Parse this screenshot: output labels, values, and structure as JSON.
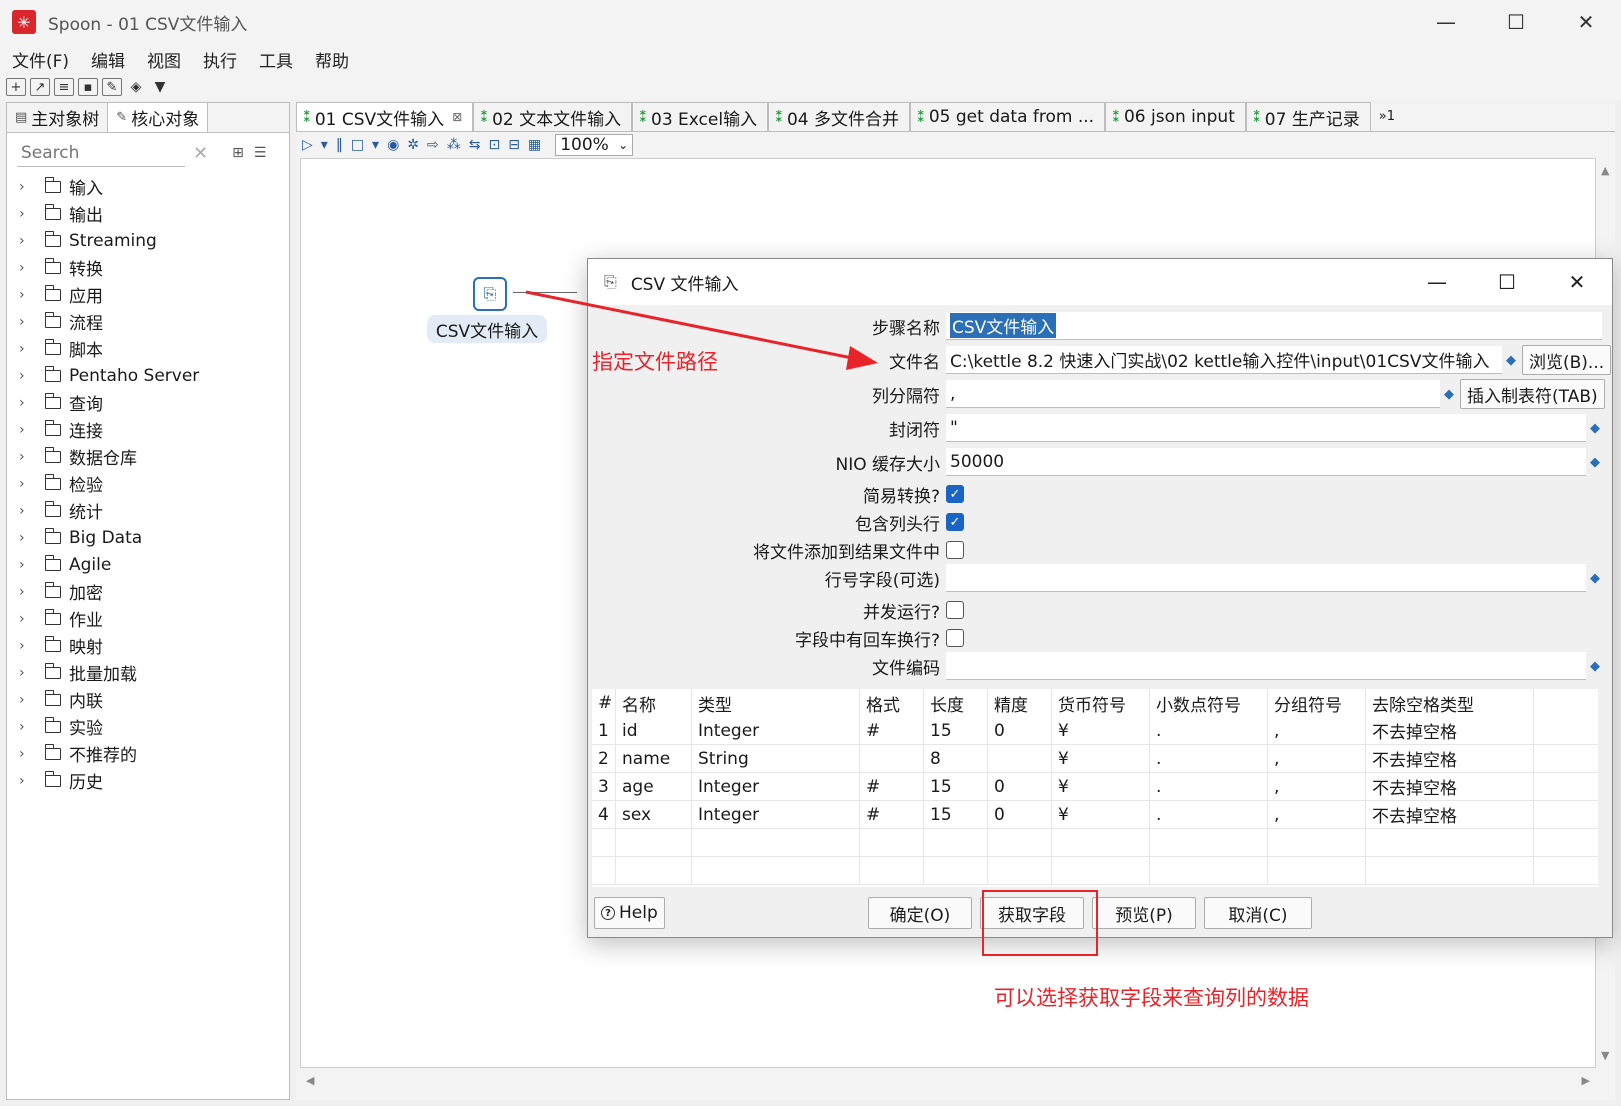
{
  "window": {
    "title": "Spoon - 01 CSV文件输入",
    "logo_icon": "spoon-logo-icon",
    "minimize": "—",
    "maximize": "☐",
    "close": "✕"
  },
  "menu": [
    "文件(F)",
    "编辑",
    "视图",
    "执行",
    "工具",
    "帮助"
  ],
  "left_panel": {
    "tabs": [
      "主对象树",
      "核心对象"
    ],
    "search_placeholder": "Search",
    "tree": [
      "输入",
      "输出",
      "Streaming",
      "转换",
      "应用",
      "流程",
      "脚本",
      "Pentaho Server",
      "查询",
      "连接",
      "数据仓库",
      "检验",
      "统计",
      "Big Data",
      "Agile",
      "加密",
      "作业",
      "映射",
      "批量加载",
      "内联",
      "实验",
      "不推荐的",
      "历史"
    ]
  },
  "editor": {
    "tabs": [
      "01 CSV文件输入",
      "02 文本文件输入",
      "03 Excel输入",
      "04 多文件合并",
      "05 get data from ...",
      "06 json input",
      "07 生产记录"
    ],
    "tab_more": "»1",
    "zoom": "100%",
    "step_label": "CSV文件输入"
  },
  "dialog": {
    "title": "CSV 文件输入",
    "fields": {
      "step_name_label": "步骤名称",
      "step_name_value": "CSV文件输入",
      "filename_label": "文件名",
      "filename_value": "C:\\kettle 8.2 快速入门实战\\02 kettle输入控件\\input\\01CSV文件输入",
      "browse_button": "浏览(B)...",
      "delimiter_label": "列分隔符",
      "delimiter_value": ",",
      "insert_tab_button": "插入制表符(TAB)",
      "enclosure_label": "封闭符",
      "enclosure_value": "\"",
      "nio_label": "NIO 缓存大小",
      "nio_value": "50000",
      "lazy_label": "简易转换?",
      "lazy_checked": true,
      "header_label": "包含列头行",
      "header_checked": true,
      "add_result_label": "将文件添加到结果文件中",
      "add_result_checked": false,
      "rownum_label": "行号字段(可选)",
      "rownum_value": "",
      "parallel_label": "并发运行?",
      "parallel_checked": false,
      "newline_label": "字段中有回车换行?",
      "newline_checked": false,
      "encoding_label": "文件编码",
      "encoding_value": ""
    },
    "table": {
      "headers": [
        "#",
        "名称",
        "类型",
        "格式",
        "长度",
        "精度",
        "货币符号",
        "小数点符号",
        "分组符号",
        "去除空格类型"
      ],
      "rows": [
        [
          "1",
          "id",
          "Integer",
          "#",
          "15",
          "0",
          "¥",
          ".",
          ",",
          "不去掉空格"
        ],
        [
          "2",
          "name",
          "String",
          "",
          "8",
          "",
          "¥",
          ".",
          ",",
          "不去掉空格"
        ],
        [
          "3",
          "age",
          "Integer",
          "#",
          "15",
          "0",
          "¥",
          ".",
          ",",
          "不去掉空格"
        ],
        [
          "4",
          "sex",
          "Integer",
          "#",
          "15",
          "0",
          "¥",
          ".",
          ",",
          "不去掉空格"
        ]
      ]
    },
    "buttons": {
      "help": "Help",
      "ok": "确定(O)",
      "get_fields": "获取字段",
      "preview": "预览(P)",
      "cancel": "取消(C)"
    }
  },
  "annotations": {
    "path_note": "指定文件路径",
    "fields_note": "可以选择获取字段来查询列的数据",
    "color": "#e8242b"
  }
}
